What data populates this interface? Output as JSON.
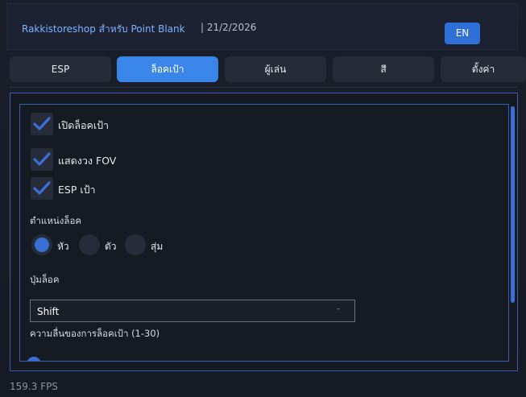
{
  "header": {
    "title": "Rakkistoreshop สำหรับ Point Blank",
    "date": "| 21/2/2026",
    "lang_button": "EN"
  },
  "tabs": [
    {
      "label": "ESP",
      "active": false
    },
    {
      "label": "ล็อคเป้า",
      "active": true
    },
    {
      "label": "ผู้เล่น",
      "active": false
    },
    {
      "label": "สี",
      "active": false
    },
    {
      "label": "ตั้งค่า",
      "active": false
    }
  ],
  "aim": {
    "enable_lock": {
      "label": "เปิดล็อคเป้า",
      "checked": true
    },
    "show_fov": {
      "label": "แสดงวง FOV",
      "checked": true
    },
    "esp_target": {
      "label": "ESP เป้า",
      "checked": true
    },
    "lock_position": {
      "label": "ตำแหน่งล็อค",
      "options": [
        "หัว",
        "ตัว",
        "สุ่ม"
      ],
      "selected": "หัว"
    },
    "lock_key": {
      "label": "ปุ่มล็อค",
      "value": "Shift"
    },
    "lock_speed": {
      "label": "ความลื่นของการล็อคเป้า (1-30)",
      "value": "1",
      "min": 1,
      "max": 30
    }
  },
  "status": {
    "fps": "159.3 FPS"
  },
  "colors": {
    "accent": "#3a86e8",
    "checkbox_tick": "#3a6fd8",
    "panel_border": "#3c5bb4"
  }
}
